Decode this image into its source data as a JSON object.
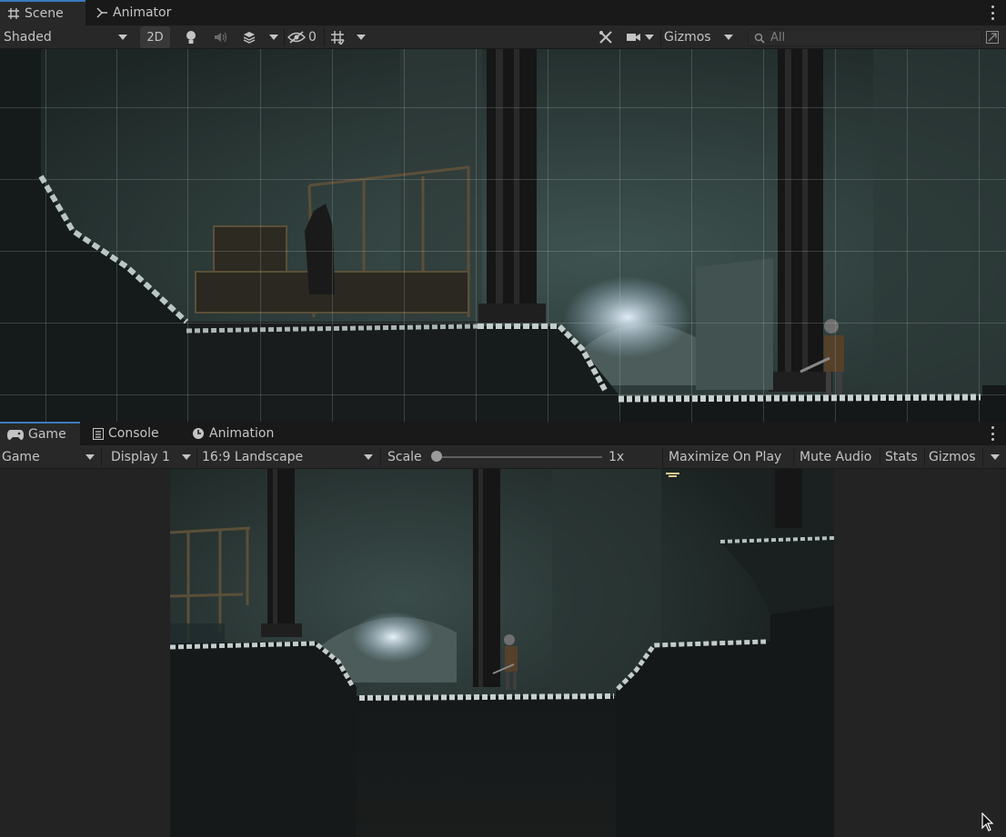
{
  "scene_panel": {
    "tabs": [
      {
        "label": "Scene",
        "icon": "grid-icon",
        "active": true
      },
      {
        "label": "Animator",
        "icon": "animator-icon",
        "active": false
      }
    ],
    "toolbar": {
      "shading_mode": "Shaded",
      "toggle_2d": "2D",
      "hidden_count": "0",
      "gizmos_label": "Gizmos",
      "search_placeholder": "All"
    }
  },
  "game_panel": {
    "tabs": [
      {
        "label": "Game",
        "icon": "gamepad-icon",
        "active": true
      },
      {
        "label": "Console",
        "icon": "console-icon",
        "active": false
      },
      {
        "label": "Animation",
        "icon": "clock-icon",
        "active": false
      }
    ],
    "toolbar": {
      "view_select": "Game",
      "display_select": "Display 1",
      "aspect_select": "16:9 Landscape",
      "scale_label": "Scale",
      "scale_value": "1x",
      "scale_fraction": 0.0,
      "maximize_label": "Maximize On Play",
      "mute_label": "Mute Audio",
      "stats_label": "Stats",
      "gizmos_label": "Gizmos"
    }
  },
  "colors": {
    "accent": "#3a79bb",
    "panel_bg": "#282828",
    "tab_bg": "#191919",
    "letterbox": "#232323"
  }
}
